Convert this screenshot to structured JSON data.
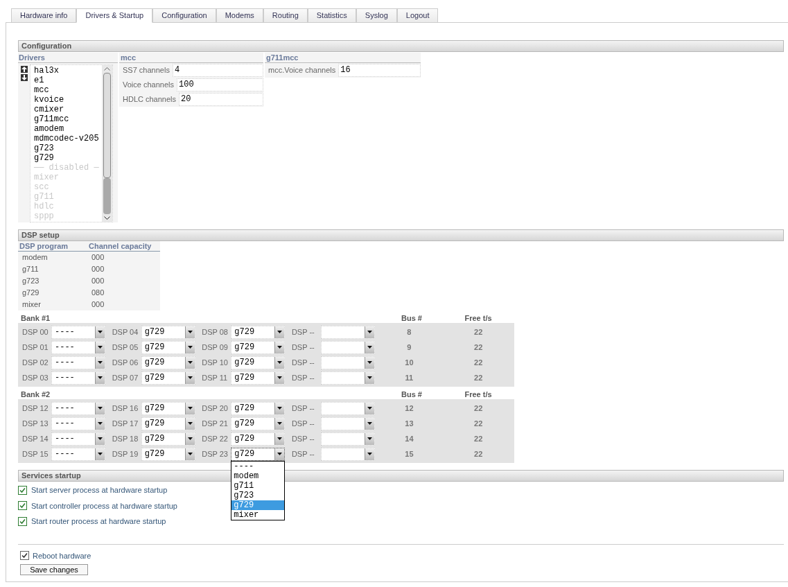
{
  "tabs": [
    {
      "label": "Hardware info",
      "selected": false
    },
    {
      "label": "Drivers & Startup",
      "selected": true
    },
    {
      "label": "Configuration",
      "selected": false
    },
    {
      "label": "Modems",
      "selected": false
    },
    {
      "label": "Routing",
      "selected": false
    },
    {
      "label": "Statistics",
      "selected": false
    },
    {
      "label": "Syslog",
      "selected": false
    },
    {
      "label": "Logout",
      "selected": false
    }
  ],
  "configuration": {
    "title": "Configuration",
    "drivers": {
      "header": "Drivers",
      "items": [
        {
          "kind": "driver",
          "name": "hal3x",
          "disabled": false
        },
        {
          "kind": "driver",
          "name": "e1",
          "disabled": false
        },
        {
          "kind": "driver",
          "name": "mcc",
          "disabled": false
        },
        {
          "kind": "driver",
          "name": "kvoice",
          "disabled": false
        },
        {
          "kind": "driver",
          "name": "cmixer",
          "disabled": false
        },
        {
          "kind": "driver",
          "name": "g711mcc",
          "disabled": false
        },
        {
          "kind": "driver",
          "name": "amodem",
          "disabled": false
        },
        {
          "kind": "driver",
          "name": "mdmcodec-v205",
          "disabled": false
        },
        {
          "kind": "driver",
          "name": "g723",
          "disabled": false
        },
        {
          "kind": "driver",
          "name": "g729",
          "disabled": false
        },
        {
          "kind": "separator",
          "name": "—— disabled —"
        },
        {
          "kind": "driver",
          "name": "mixer",
          "disabled": true
        },
        {
          "kind": "driver",
          "name": "scc",
          "disabled": true
        },
        {
          "kind": "driver",
          "name": "g711",
          "disabled": true
        },
        {
          "kind": "driver",
          "name": "hdlc",
          "disabled": true
        },
        {
          "kind": "driver",
          "name": "sppp",
          "disabled": true
        }
      ]
    },
    "groups": [
      {
        "header": "mcc",
        "fields": [
          {
            "label": "SS7 channels",
            "value": "4"
          },
          {
            "label": "Voice channels",
            "value": "100"
          },
          {
            "label": "HDLC channels",
            "value": "20"
          }
        ]
      },
      {
        "header": "g711mcc",
        "fields": [
          {
            "label": "mcc.Voice channels",
            "value": "16"
          }
        ]
      }
    ]
  },
  "dsp_setup": {
    "title": "DSP setup",
    "programs": {
      "columns": [
        "DSP program",
        "Channel capacity"
      ],
      "rows": [
        [
          "modem",
          "000"
        ],
        [
          "g711",
          "000"
        ],
        [
          "g723",
          "000"
        ],
        [
          "g729",
          "080"
        ],
        [
          "mixer",
          "000"
        ]
      ]
    },
    "banks": [
      {
        "title": "Bank #1",
        "bus_header": "Bus #",
        "free_header": "Free t/s",
        "rows": [
          {
            "dsps": [
              {
                "label": "DSP 00",
                "value": "----"
              },
              {
                "label": "DSP 04",
                "value": "g729"
              },
              {
                "label": "DSP 08",
                "value": "g729"
              },
              {
                "label": "DSP --"
              }
            ],
            "bus": "8",
            "free": "22"
          },
          {
            "dsps": [
              {
                "label": "DSP 01",
                "value": "----"
              },
              {
                "label": "DSP 05",
                "value": "g729"
              },
              {
                "label": "DSP 09",
                "value": "g729"
              },
              {
                "label": "DSP --"
              }
            ],
            "bus": "9",
            "free": "22"
          },
          {
            "dsps": [
              {
                "label": "DSP 02",
                "value": "----"
              },
              {
                "label": "DSP 06",
                "value": "g729"
              },
              {
                "label": "DSP 10",
                "value": "g729"
              },
              {
                "label": "DSP --"
              }
            ],
            "bus": "10",
            "free": "22"
          },
          {
            "dsps": [
              {
                "label": "DSP 03",
                "value": "----"
              },
              {
                "label": "DSP 07",
                "value": "g729"
              },
              {
                "label": "DSP 11",
                "value": "g729"
              },
              {
                "label": "DSP --"
              }
            ],
            "bus": "11",
            "free": "22"
          }
        ]
      },
      {
        "title": "Bank #2",
        "bus_header": "Bus #",
        "free_header": "Free t/s",
        "rows": [
          {
            "dsps": [
              {
                "label": "DSP 12",
                "value": "----"
              },
              {
                "label": "DSP 16",
                "value": "g729"
              },
              {
                "label": "DSP 20",
                "value": "g729"
              },
              {
                "label": "DSP --"
              }
            ],
            "bus": "12",
            "free": "22"
          },
          {
            "dsps": [
              {
                "label": "DSP 13",
                "value": "----"
              },
              {
                "label": "DSP 17",
                "value": "g729"
              },
              {
                "label": "DSP 21",
                "value": "g729"
              },
              {
                "label": "DSP --"
              }
            ],
            "bus": "13",
            "free": "22"
          },
          {
            "dsps": [
              {
                "label": "DSP 14",
                "value": "----"
              },
              {
                "label": "DSP 18",
                "value": "g729"
              },
              {
                "label": "DSP 22",
                "value": "g729"
              },
              {
                "label": "DSP --"
              }
            ],
            "bus": "14",
            "free": "22"
          },
          {
            "dsps": [
              {
                "label": "DSP 15",
                "value": "----"
              },
              {
                "label": "DSP 19",
                "value": "g729"
              },
              {
                "label": "DSP 23",
                "value": "g729",
                "focused": true,
                "options": [
                  {
                    "label": "----",
                    "selected": false
                  },
                  {
                    "label": "modem",
                    "selected": false
                  },
                  {
                    "label": "g711",
                    "selected": false
                  },
                  {
                    "label": "g723",
                    "selected": false
                  },
                  {
                    "label": "g729",
                    "selected": true
                  },
                  {
                    "label": "mixer",
                    "selected": false
                  }
                ]
              },
              {
                "label": "DSP --"
              }
            ],
            "bus": "15",
            "free": "22"
          }
        ]
      }
    ]
  },
  "services": {
    "title": "Services startup",
    "items": [
      {
        "label": "Start server process at hardware startup",
        "checked": true
      },
      {
        "label": "Start controller process at hardware startup",
        "checked": true
      },
      {
        "label": "Start router process at hardware startup",
        "checked": true
      }
    ]
  },
  "reboot": {
    "label": "Reboot hardware",
    "checked": true
  },
  "save_button": "Save changes"
}
